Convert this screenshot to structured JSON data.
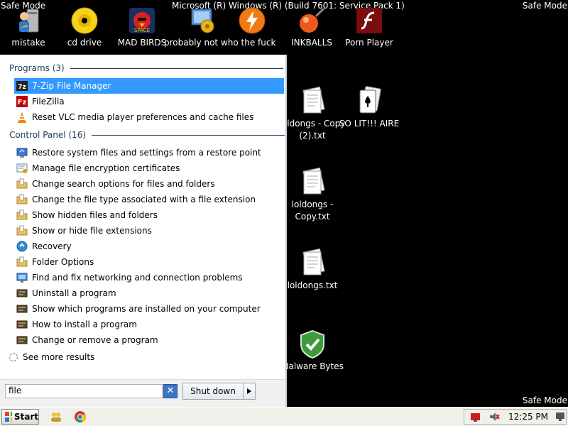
{
  "watermarks": {
    "top_left": "Safe Mode",
    "top_right": "Safe Mode",
    "bottom_right": "Safe Mode",
    "top_center": "Microsoft (R) Windows (R) (Build 7601: Service Pack 1)"
  },
  "desktop_icons_top": [
    {
      "label": "mistake",
      "icon": "installer-icon"
    },
    {
      "label": "cd drive",
      "icon": "cd-drive-icon"
    },
    {
      "label": "MAD BIRDS",
      "icon": "mad-birds-icon"
    },
    {
      "label": "probably not who the fuck",
      "icon": "settings-program-icon"
    },
    {
      "label": "INKBALLS",
      "icon": "inkballs-icon"
    },
    {
      "label": "Porn Player",
      "icon": "flash-player-icon"
    }
  ],
  "desktop_icons_right": [
    {
      "label": "loldongs - Copy (2).txt",
      "icon": "text-file-icon"
    },
    {
      "label": "SO LIT!!! AIRE",
      "icon": "cards-game-icon"
    },
    {
      "label": "loldongs - Copy.txt",
      "icon": "text-file-icon"
    },
    {
      "label": "loldongs.txt",
      "icon": "text-file-icon"
    },
    {
      "label": "Malware Bytes",
      "icon": "shield-check-icon"
    }
  ],
  "start_menu": {
    "programs_heading": "Programs (3)",
    "programs": [
      {
        "label": "7-Zip File Manager",
        "icon": "7zip-icon",
        "selected": true
      },
      {
        "label": "FileZilla",
        "icon": "filezilla-icon",
        "selected": false
      },
      {
        "label": "Reset VLC media player preferences and cache files",
        "icon": "vlc-cone-icon",
        "selected": false
      }
    ],
    "control_panel_heading": "Control Panel (16)",
    "control_panel": [
      {
        "label": "Restore system files and settings from a restore point",
        "icon": "system-restore-icon"
      },
      {
        "label": "Manage file encryption certificates",
        "icon": "certificate-icon"
      },
      {
        "label": "Change search options for files and folders",
        "icon": "folder-options-icon"
      },
      {
        "label": "Change the file type associated with a file extension",
        "icon": "folder-options-icon"
      },
      {
        "label": "Show hidden files and folders",
        "icon": "folder-options-icon"
      },
      {
        "label": "Show or hide file extensions",
        "icon": "folder-options-icon"
      },
      {
        "label": "Recovery",
        "icon": "recovery-icon"
      },
      {
        "label": "Folder Options",
        "icon": "folder-options-icon"
      },
      {
        "label": "Find and fix networking and connection problems",
        "icon": "troubleshoot-icon"
      },
      {
        "label": "Uninstall a program",
        "icon": "programs-icon"
      },
      {
        "label": "Show which programs are installed on your computer",
        "icon": "programs-icon"
      },
      {
        "label": "How to install a program",
        "icon": "programs-icon"
      },
      {
        "label": "Change or remove a program",
        "icon": "programs-icon"
      }
    ],
    "see_more": "See more results",
    "search_value": "file",
    "shutdown_label": "Shut down"
  },
  "taskbar": {
    "start_label": "Start",
    "clock": "12:25 PM"
  },
  "colors": {
    "selection": "#3399ff",
    "heading": "#1e395b",
    "desktop": "#000000"
  }
}
